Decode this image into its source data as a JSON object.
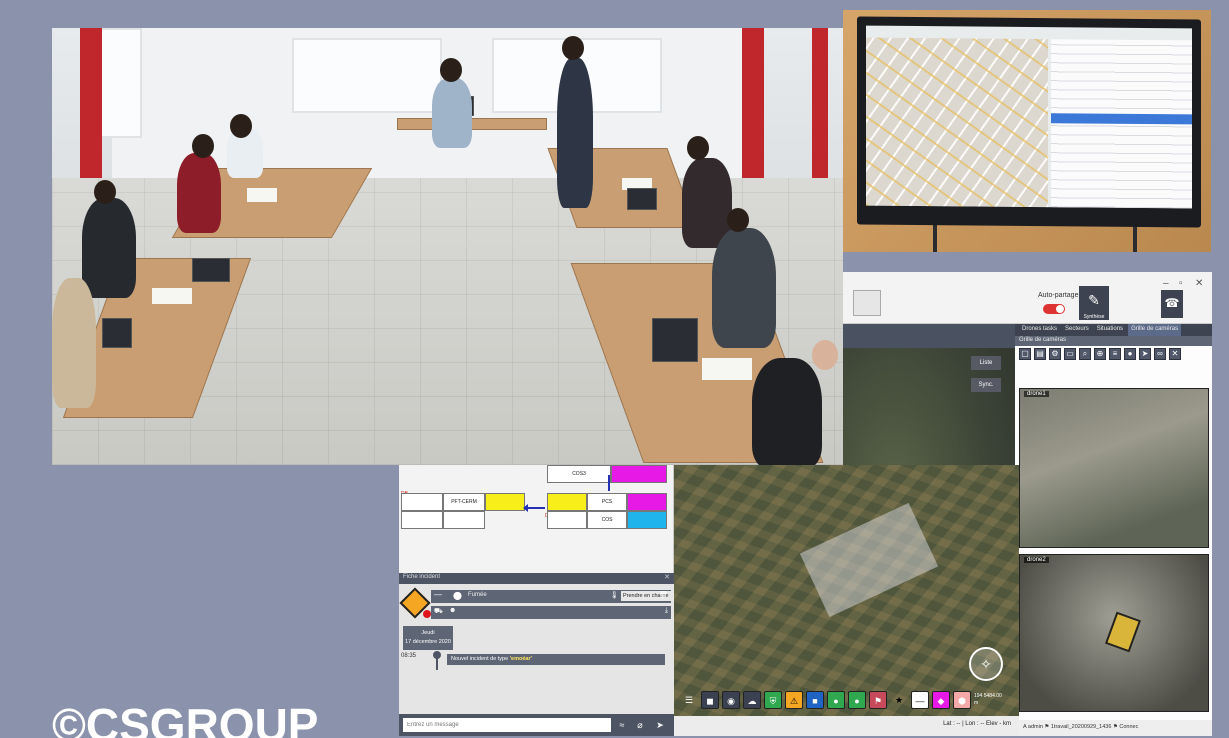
{
  "watermark": "©CSGROUP",
  "cartography_app": {
    "window_controls": [
      "–",
      "▫",
      "✕"
    ],
    "auto_partage_label": "Auto-partage",
    "edit_button_caption": "Synthèse",
    "phone_button_caption": "Appeler",
    "tabs": [
      "Drones tasks",
      "Secteurs",
      "Situations",
      "Grille de caméras"
    ],
    "active_tab": "Grille de caméras",
    "grid_title": "Grille de caméras",
    "camera_labels": [
      "drone1",
      "drone2"
    ],
    "map_buttons": [
      "Liste",
      "Sync."
    ],
    "status_bar": "Lat : -- | Lon : -- Elev - km",
    "session_status": "A admin ⚑ 1travail_20200929_1436 ⚑ Connec"
  },
  "incident_ui": {
    "diagram_boxes": [
      "COS3",
      "PFT-CERM",
      "PCS",
      "COS"
    ],
    "diagram_tags": [
      "DB",
      "DB"
    ],
    "panel_title": "Fiche incident",
    "type_value": "Fumée",
    "take_charge_button": "Prendre en charge",
    "date_badge_line1": "Jeudi",
    "date_badge_line2": "17 décembre 2020",
    "message_time": "08:35",
    "message_text_prefix": "Nouvel incident de type ",
    "message_type": "'emoéar'",
    "message_placeholder": "Entrez un message",
    "coords_display": "194 5484.00 m"
  }
}
